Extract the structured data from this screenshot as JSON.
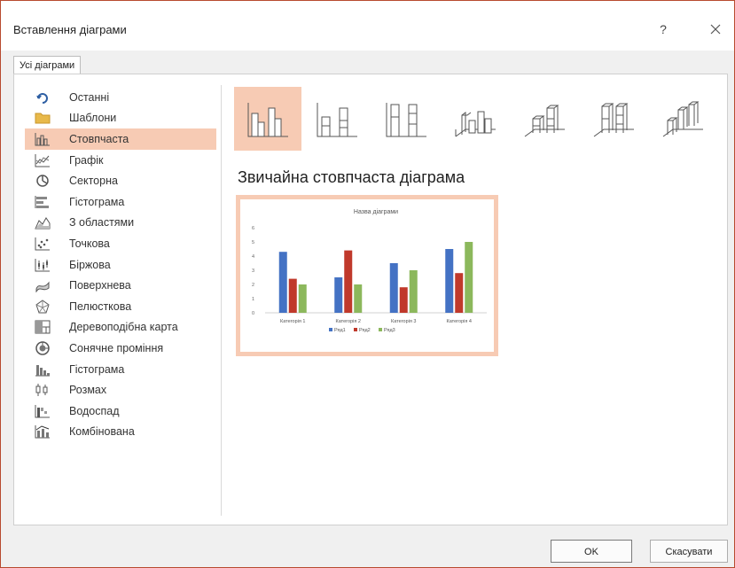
{
  "dialog": {
    "title": "Вставлення діаграми",
    "help_label": "?",
    "close_icon": "close-icon"
  },
  "tabs": [
    {
      "label": "Усі діаграми",
      "selected": true
    }
  ],
  "sidebar": {
    "items": [
      {
        "label": "Останні",
        "icon": "recent-icon"
      },
      {
        "label": "Шаблони",
        "icon": "folder-icon"
      },
      {
        "label": "Стовпчаста",
        "icon": "column-chart-icon",
        "selected": true
      },
      {
        "label": "Графік",
        "icon": "line-chart-icon"
      },
      {
        "label": "Секторна",
        "icon": "pie-chart-icon"
      },
      {
        "label": "Гістограма",
        "icon": "bar-chart-icon"
      },
      {
        "label": "З областями",
        "icon": "area-chart-icon"
      },
      {
        "label": "Точкова",
        "icon": "scatter-chart-icon"
      },
      {
        "label": "Біржова",
        "icon": "stock-chart-icon"
      },
      {
        "label": "Поверхнева",
        "icon": "surface-chart-icon"
      },
      {
        "label": "Пелюсткова",
        "icon": "radar-chart-icon"
      },
      {
        "label": "Деревоподібна карта",
        "icon": "treemap-chart-icon"
      },
      {
        "label": "Сонячне проміння",
        "icon": "sunburst-chart-icon"
      },
      {
        "label": "Гістограма",
        "icon": "histogram-chart-icon"
      },
      {
        "label": "Розмах",
        "icon": "box-whisker-chart-icon"
      },
      {
        "label": "Водоспад",
        "icon": "waterfall-chart-icon"
      },
      {
        "label": "Комбінована",
        "icon": "combo-chart-icon"
      }
    ]
  },
  "subtypes": [
    {
      "icon": "clustered-column-icon",
      "selected": true
    },
    {
      "icon": "stacked-column-icon"
    },
    {
      "icon": "100-stacked-column-icon"
    },
    {
      "icon": "3d-clustered-column-icon"
    },
    {
      "icon": "3d-stacked-column-icon"
    },
    {
      "icon": "3d-100-stacked-column-icon"
    },
    {
      "icon": "3d-column-icon"
    }
  ],
  "selected_chart_name": "Звичайна стовпчаста діаграма",
  "colors": {
    "accent": "#f7cbb4",
    "series1": "#4472c4",
    "series2": "#c0392b",
    "series3": "#8cb85c"
  },
  "chart_data": {
    "type": "bar",
    "title": "Назва діаграми",
    "categories": [
      "Категорія 1",
      "Категорія 2",
      "Категорія 3",
      "Категорія 4"
    ],
    "series": [
      {
        "name": "Ряд1",
        "values": [
          4.3,
          2.5,
          3.5,
          4.5
        ]
      },
      {
        "name": "Ряд2",
        "values": [
          2.4,
          4.4,
          1.8,
          2.8
        ]
      },
      {
        "name": "Ряд3",
        "values": [
          2,
          2,
          3,
          5
        ]
      }
    ],
    "yticks": [
      "0",
      "1",
      "2",
      "3",
      "4",
      "5",
      "6"
    ],
    "ylim": [
      0,
      6
    ],
    "grid": false,
    "legend": "bottom"
  },
  "buttons": {
    "ok": "OK",
    "cancel": "Скасувати"
  }
}
